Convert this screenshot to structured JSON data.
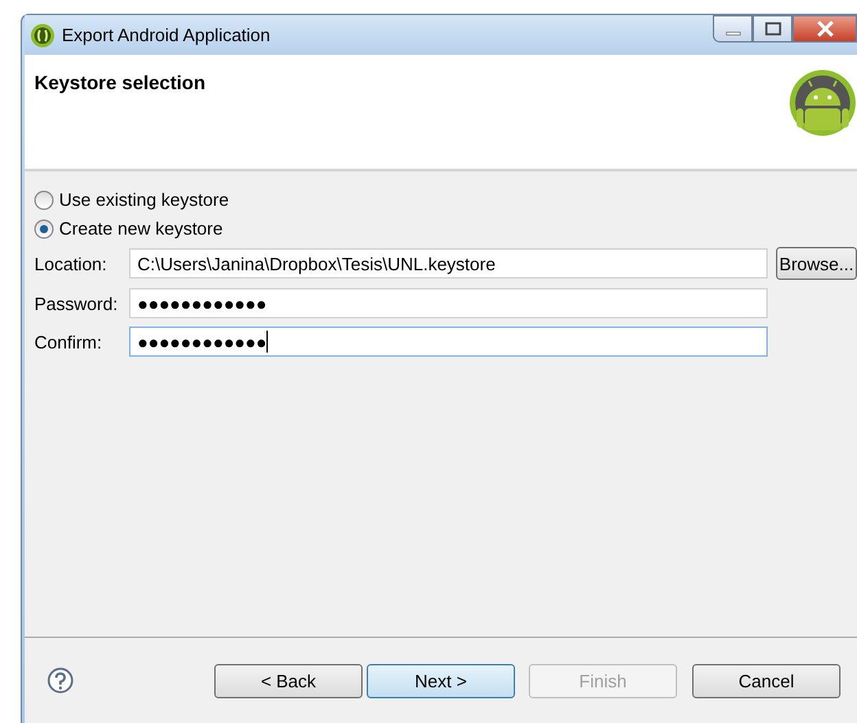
{
  "window": {
    "title": "Export Android Application"
  },
  "header": {
    "title": "Keystore selection"
  },
  "options": [
    {
      "label": "Use existing keystore",
      "selected": false
    },
    {
      "label": "Create new keystore",
      "selected": true
    }
  ],
  "fields": [
    {
      "label": "Location:",
      "value": "C:\\Users\\Janina\\Dropbox\\Tesis\\UNL.keystore",
      "focused": false,
      "button": "Browse..."
    },
    {
      "label": "Password:",
      "value": "●●●●●●●●●●●●",
      "focused": false
    },
    {
      "label": "Confirm:",
      "value": "●●●●●●●●●●●●",
      "focused": true
    }
  ],
  "buttons": [
    {
      "label": "< Back",
      "kind": "normal",
      "disabled": false
    },
    {
      "label": "Next >",
      "kind": "default",
      "disabled": false
    },
    {
      "label": "Finish",
      "kind": "normal",
      "disabled": true
    },
    {
      "label": "Cancel",
      "kind": "normal",
      "disabled": false
    }
  ]
}
